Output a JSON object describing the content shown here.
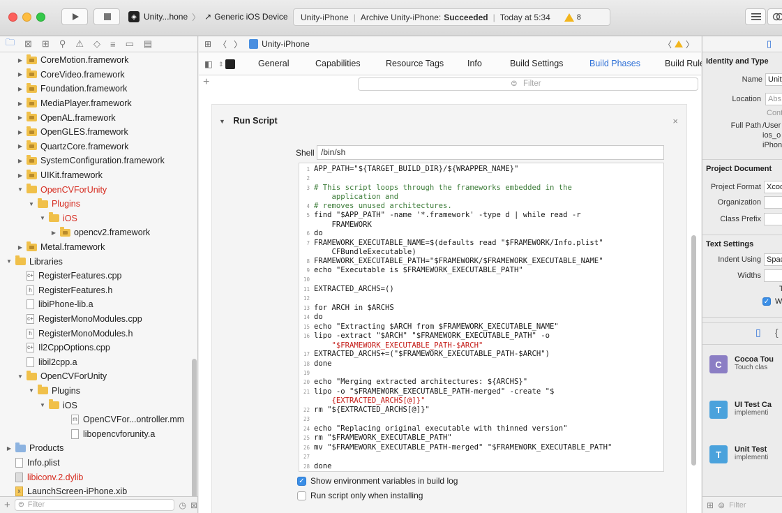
{
  "toolbar": {
    "scheme_app": "Unity...hone",
    "scheme_device": "Generic iOS Device",
    "status_project": "Unity-iPhone",
    "status_action": "Archive Unity-iPhone:",
    "status_result": "Succeeded",
    "status_time": "Today at 5:34",
    "warning_count": "8"
  },
  "navigator": {
    "filter_placeholder": "Filter",
    "tree": [
      {
        "label": "CoreMotion.framework",
        "indent": 1,
        "icon": "framework",
        "disclosure": "closed"
      },
      {
        "label": "CoreVideo.framework",
        "indent": 1,
        "icon": "framework",
        "disclosure": "closed"
      },
      {
        "label": "Foundation.framework",
        "indent": 1,
        "icon": "framework",
        "disclosure": "closed"
      },
      {
        "label": "MediaPlayer.framework",
        "indent": 1,
        "icon": "framework",
        "disclosure": "closed"
      },
      {
        "label": "OpenAL.framework",
        "indent": 1,
        "icon": "framework",
        "disclosure": "closed"
      },
      {
        "label": "OpenGLES.framework",
        "indent": 1,
        "icon": "framework",
        "disclosure": "closed"
      },
      {
        "label": "QuartzCore.framework",
        "indent": 1,
        "icon": "framework",
        "disclosure": "closed"
      },
      {
        "label": "SystemConfiguration.framework",
        "indent": 1,
        "icon": "framework",
        "disclosure": "closed"
      },
      {
        "label": "UIKit.framework",
        "indent": 1,
        "icon": "framework",
        "disclosure": "closed"
      },
      {
        "label": "OpenCVForUnity",
        "indent": 1,
        "icon": "folder",
        "disclosure": "open",
        "red": true
      },
      {
        "label": "Plugins",
        "indent": 2,
        "icon": "folder",
        "disclosure": "open",
        "red": true
      },
      {
        "label": "iOS",
        "indent": 3,
        "icon": "folder",
        "disclosure": "open",
        "red": true
      },
      {
        "label": "opencv2.framework",
        "indent": 4,
        "icon": "framework",
        "disclosure": "closed"
      },
      {
        "label": "Metal.framework",
        "indent": 1,
        "icon": "framework",
        "disclosure": "closed"
      },
      {
        "label": "Libraries",
        "indent": 0,
        "icon": "folder",
        "disclosure": "open"
      },
      {
        "label": "RegisterFeatures.cpp",
        "indent": 1,
        "icon": "file",
        "badge": "c+"
      },
      {
        "label": "RegisterFeatures.h",
        "indent": 1,
        "icon": "file",
        "badge": "h"
      },
      {
        "label": "libiPhone-lib.a",
        "indent": 1,
        "icon": "file",
        "badge": ""
      },
      {
        "label": "RegisterMonoModules.cpp",
        "indent": 1,
        "icon": "file",
        "badge": "c+"
      },
      {
        "label": "RegisterMonoModules.h",
        "indent": 1,
        "icon": "file",
        "badge": "h"
      },
      {
        "label": "Il2CppOptions.cpp",
        "indent": 1,
        "icon": "file",
        "badge": "c+"
      },
      {
        "label": "libil2cpp.a",
        "indent": 1,
        "icon": "file",
        "badge": ""
      },
      {
        "label": "OpenCVForUnity",
        "indent": 1,
        "icon": "folder",
        "disclosure": "open"
      },
      {
        "label": "Plugins",
        "indent": 2,
        "icon": "folder",
        "disclosure": "open"
      },
      {
        "label": "iOS",
        "indent": 3,
        "icon": "folder",
        "disclosure": "open"
      },
      {
        "label": "OpenCVFor...ontroller.mm",
        "indent": 5,
        "icon": "file",
        "badge": "m"
      },
      {
        "label": "libopencvforunity.a",
        "indent": 5,
        "icon": "file",
        "badge": ""
      },
      {
        "label": "Products",
        "indent": 0,
        "icon": "folder-blue",
        "disclosure": "closed"
      },
      {
        "label": "Info.plist",
        "indent": 0,
        "icon": "file",
        "badge": ""
      },
      {
        "label": "libiconv.2.dylib",
        "indent": 0,
        "icon": "file",
        "badge": "",
        "red": true
      },
      {
        "label": "LaunchScreen-iPhone.xib",
        "indent": 0,
        "icon": "file",
        "badge": "x"
      }
    ]
  },
  "editor": {
    "breadcrumb": "Unity-iPhone",
    "tabs": [
      "General",
      "Capabilities",
      "Resource Tags",
      "Info",
      "Build Settings",
      "Build Phases",
      "Build Rule"
    ],
    "active_tab": "Build Phases",
    "filter_placeholder": "Filter",
    "phase_title": "Run Script",
    "shell_label": "Shell",
    "shell_value": "/bin/sh",
    "script_lines": [
      {
        "n": "1",
        "t": "APP_PATH=\"${TARGET_BUILD_DIR}/${WRAPPER_NAME}\""
      },
      {
        "n": "2",
        "t": ""
      },
      {
        "n": "3",
        "t": "# This script loops through the frameworks embedded in the"
      },
      {
        "n": "",
        "t": "    application and"
      },
      {
        "n": "4",
        "t": "# removes unused architectures."
      },
      {
        "n": "5",
        "t": "find \"$APP_PATH\" -name '*.framework' -type d | while read -r"
      },
      {
        "n": "",
        "t": "    FRAMEWORK"
      },
      {
        "n": "6",
        "t": "do"
      },
      {
        "n": "7",
        "t": "FRAMEWORK_EXECUTABLE_NAME=$(defaults read \"$FRAMEWORK/Info.plist\""
      },
      {
        "n": "",
        "t": "    CFBundleExecutable)"
      },
      {
        "n": "8",
        "t": "FRAMEWORK_EXECUTABLE_PATH=\"$FRAMEWORK/$FRAMEWORK_EXECUTABLE_NAME\""
      },
      {
        "n": "9",
        "t": "echo \"Executable is $FRAMEWORK_EXECUTABLE_PATH\""
      },
      {
        "n": "10",
        "t": ""
      },
      {
        "n": "11",
        "t": "EXTRACTED_ARCHS=()"
      },
      {
        "n": "12",
        "t": ""
      },
      {
        "n": "13",
        "t": "for ARCH in $ARCHS"
      },
      {
        "n": "14",
        "t": "do"
      },
      {
        "n": "15",
        "t": "echo \"Extracting $ARCH from $FRAMEWORK_EXECUTABLE_NAME\""
      },
      {
        "n": "16",
        "t": "lipo -extract \"$ARCH\" \"$FRAMEWORK_EXECUTABLE_PATH\" -o"
      },
      {
        "n": "",
        "t": "    \"$FRAMEWORK_EXECUTABLE_PATH-$ARCH\""
      },
      {
        "n": "17",
        "t": "EXTRACTED_ARCHS+=(\"$FRAMEWORK_EXECUTABLE_PATH-$ARCH\")"
      },
      {
        "n": "18",
        "t": "done"
      },
      {
        "n": "19",
        "t": ""
      },
      {
        "n": "20",
        "t": "echo \"Merging extracted architectures: ${ARCHS}\""
      },
      {
        "n": "21",
        "t": "lipo -o \"$FRAMEWORK_EXECUTABLE_PATH-merged\" -create \"$"
      },
      {
        "n": "",
        "t": "    {EXTRACTED_ARCHS[@]}\""
      },
      {
        "n": "22",
        "t": "rm \"${EXTRACTED_ARCHS[@]}\""
      },
      {
        "n": "23",
        "t": ""
      },
      {
        "n": "24",
        "t": "echo \"Replacing original executable with thinned version\""
      },
      {
        "n": "25",
        "t": "rm \"$FRAMEWORK_EXECUTABLE_PATH\""
      },
      {
        "n": "26",
        "t": "mv \"$FRAMEWORK_EXECUTABLE_PATH-merged\" \"$FRAMEWORK_EXECUTABLE_PATH\""
      },
      {
        "n": "27",
        "t": ""
      },
      {
        "n": "28",
        "t": "done"
      }
    ],
    "show_env_label": "Show environment variables in build log",
    "show_env_checked": true,
    "run_only_installing_label": "Run script only when installing",
    "run_only_installing_checked": false
  },
  "inspector": {
    "identity_title": "Identity and Type",
    "name_label": "Name",
    "name_value": "Unity",
    "location_label": "Location",
    "location_value": "Abs",
    "location_sub": "Conta",
    "fullpath_label": "Full Path",
    "fullpath_l1": "/User",
    "fullpath_l2": "ios_o",
    "fullpath_l3": "iPhon",
    "project_doc_title": "Project Document",
    "project_format_label": "Project Format",
    "project_format_value": "Xcod",
    "organization_label": "Organization",
    "class_prefix_label": "Class Prefix",
    "text_settings_title": "Text Settings",
    "indent_using_label": "Indent Using",
    "indent_using_value": "Spac",
    "widths_label": "Widths",
    "tab_label_fragment": "T",
    "wrap_label": "Wr",
    "templates": [
      {
        "title": "Cocoa Tou",
        "desc": "Touch clas",
        "icon_letter": "C",
        "color": "#8b7ec4"
      },
      {
        "title": "UI Test Ca",
        "desc": "implementi",
        "icon_letter": "T",
        "color": "#4aa2dc"
      },
      {
        "title": "Unit Test",
        "desc": "implementi",
        "icon_letter": "T",
        "color": "#4aa2dc"
      }
    ],
    "filter_placeholder": "Filter"
  }
}
